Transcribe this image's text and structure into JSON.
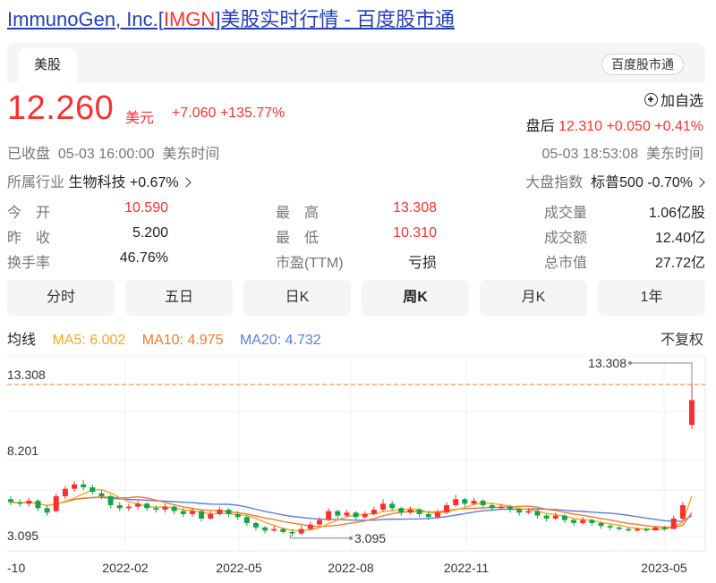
{
  "header": {
    "title_prefix": "ImmunoGen, Inc.[",
    "ticker": "IMGN",
    "title_suffix": "]美股实时行情 - 百度股市通"
  },
  "tabs": {
    "active": "美股",
    "brand_button": "百度股市通"
  },
  "quote": {
    "price": "12.260",
    "currency": "美元",
    "change": "+7.060 +135.77%",
    "add_watchlist": "加自选",
    "after_label": "盘后",
    "after_values": "12.310 +0.050 +0.41%",
    "status_left": "已收盘  05-03 16:00:00  美东时间",
    "status_right": "05-03 18:53:08  美东时间",
    "industry_label": "所属行业",
    "industry_value": "生物科技 +0.67%",
    "index_label": "大盘指数",
    "index_value": "标普500 -0.70%"
  },
  "stats": [
    [
      {
        "label": "今　开",
        "value": "10.590",
        "color": "#f73131"
      },
      {
        "label": "最　高",
        "value": "13.308",
        "color": "#f73131"
      },
      {
        "label": "成交量",
        "value": "1.06亿股",
        "color": "#222"
      }
    ],
    [
      {
        "label": "昨　收",
        "value": "5.200",
        "color": "#222"
      },
      {
        "label": "最　低",
        "value": "10.310",
        "color": "#f73131"
      },
      {
        "label": "成交额",
        "value": "12.40亿",
        "color": "#222"
      }
    ],
    [
      {
        "label": "换手率",
        "value": "46.76%",
        "color": "#222"
      },
      {
        "label": "市盈(TTM)",
        "value": "亏损",
        "color": "#222"
      },
      {
        "label": "总市值",
        "value": "27.72亿",
        "color": "#222"
      }
    ]
  ],
  "periods": [
    "分时",
    "五日",
    "日K",
    "周K",
    "月K",
    "1年"
  ],
  "active_period": "周K",
  "ma": {
    "label": "均线",
    "ma5": "MA5: 6.002",
    "ma5_color": "#f5a623",
    "ma10": "MA10: 4.975",
    "ma10_color": "#f07a2a",
    "ma20": "MA20: 4.732",
    "ma20_color": "#5b7fd6",
    "adjust": "不复权"
  },
  "chart_data": {
    "type": "candlestick",
    "y_ticks": [
      "13.308",
      "8.201",
      "3.095"
    ],
    "x_ticks": [
      "-10",
      "2022-02",
      "2022-05",
      "2022-08",
      "2022-11",
      "2023-05"
    ],
    "ylim": [
      3.095,
      13.308
    ],
    "max_label": "13.308",
    "min_label": "3.095",
    "up_color": "#f73131",
    "down_color": "#16a34a",
    "candles": [
      [
        5.6,
        5.4,
        5.8,
        5.2
      ],
      [
        5.4,
        5.3,
        5.6,
        5.1
      ],
      [
        5.3,
        5.5,
        5.7,
        5.1
      ],
      [
        5.5,
        5.0,
        5.6,
        4.8
      ],
      [
        5.0,
        4.7,
        5.2,
        4.5
      ],
      [
        4.8,
        5.8,
        6.0,
        4.7
      ],
      [
        5.8,
        6.3,
        6.5,
        5.6
      ],
      [
        6.3,
        6.6,
        6.8,
        6.1
      ],
      [
        6.6,
        6.4,
        6.9,
        6.2
      ],
      [
        6.4,
        6.1,
        6.6,
        5.9
      ],
      [
        6.0,
        5.8,
        6.2,
        5.6
      ],
      [
        5.8,
        5.2,
        5.9,
        5.0
      ],
      [
        5.2,
        5.0,
        5.4,
        4.8
      ],
      [
        5.0,
        5.1,
        5.3,
        4.8
      ],
      [
        5.1,
        5.3,
        5.5,
        4.9
      ],
      [
        5.3,
        5.0,
        5.4,
        4.8
      ],
      [
        5.0,
        4.9,
        5.2,
        4.7
      ],
      [
        4.9,
        5.1,
        5.3,
        4.7
      ],
      [
        5.1,
        4.8,
        5.2,
        4.6
      ],
      [
        4.8,
        4.6,
        5.0,
        4.4
      ],
      [
        4.6,
        4.8,
        5.0,
        4.4
      ],
      [
        4.8,
        4.3,
        4.9,
        4.1
      ],
      [
        4.3,
        4.6,
        4.8,
        4.2
      ],
      [
        4.6,
        4.9,
        5.1,
        4.5
      ],
      [
        4.9,
        4.6,
        5.0,
        4.4
      ],
      [
        4.6,
        4.4,
        4.8,
        4.2
      ],
      [
        4.4,
        4.0,
        4.5,
        3.8
      ],
      [
        4.0,
        3.7,
        4.1,
        3.5
      ],
      [
        3.7,
        3.5,
        3.8,
        3.3
      ],
      [
        3.5,
        3.6,
        3.8,
        3.4
      ],
      [
        3.6,
        3.4,
        3.7,
        3.3
      ],
      [
        3.4,
        3.3,
        3.6,
        3.1
      ],
      [
        3.3,
        3.6,
        3.8,
        3.2
      ],
      [
        3.6,
        3.9,
        4.1,
        3.5
      ],
      [
        3.9,
        4.2,
        4.4,
        3.8
      ],
      [
        4.2,
        4.8,
        5.0,
        4.1
      ],
      [
        4.8,
        4.5,
        4.9,
        4.3
      ],
      [
        4.5,
        4.7,
        4.9,
        4.4
      ],
      [
        4.7,
        4.4,
        4.8,
        4.2
      ],
      [
        4.4,
        4.6,
        4.8,
        4.3
      ],
      [
        4.6,
        4.9,
        5.1,
        4.5
      ],
      [
        4.9,
        5.3,
        5.6,
        4.8
      ],
      [
        5.3,
        5.0,
        5.5,
        4.8
      ],
      [
        5.0,
        4.7,
        5.1,
        4.5
      ],
      [
        4.7,
        4.9,
        5.1,
        4.6
      ],
      [
        4.9,
        4.6,
        5.0,
        4.4
      ],
      [
        4.6,
        4.4,
        4.8,
        4.2
      ],
      [
        4.4,
        4.7,
        4.9,
        4.3
      ],
      [
        4.7,
        5.2,
        5.4,
        4.6
      ],
      [
        5.2,
        5.6,
        5.9,
        5.1
      ],
      [
        5.6,
        5.3,
        5.7,
        5.1
      ],
      [
        5.3,
        5.5,
        5.7,
        5.2
      ],
      [
        5.5,
        5.2,
        5.6,
        5.0
      ],
      [
        5.2,
        5.0,
        5.3,
        4.8
      ],
      [
        5.0,
        5.1,
        5.3,
        4.9
      ],
      [
        5.1,
        4.9,
        5.2,
        4.7
      ],
      [
        4.9,
        4.7,
        5.0,
        4.5
      ],
      [
        4.7,
        4.8,
        5.0,
        4.6
      ],
      [
        4.8,
        4.5,
        4.9,
        4.3
      ],
      [
        4.5,
        4.3,
        4.6,
        4.1
      ],
      [
        4.3,
        4.5,
        4.7,
        4.2
      ],
      [
        4.5,
        4.2,
        4.6,
        4.0
      ],
      [
        4.2,
        4.0,
        4.3,
        3.8
      ],
      [
        4.0,
        4.2,
        4.4,
        3.9
      ],
      [
        4.2,
        4.0,
        4.3,
        3.8
      ],
      [
        4.0,
        3.8,
        4.1,
        3.6
      ],
      [
        3.8,
        3.7,
        3.9,
        3.5
      ],
      [
        3.7,
        3.6,
        3.8,
        3.5
      ],
      [
        3.6,
        3.5,
        3.7,
        3.4
      ],
      [
        3.5,
        3.6,
        3.7,
        3.4
      ],
      [
        3.6,
        3.5,
        3.7,
        3.4
      ],
      [
        3.5,
        3.7,
        3.8,
        3.5
      ],
      [
        3.7,
        3.6,
        3.8,
        3.5
      ],
      [
        3.6,
        4.3,
        4.5,
        3.6
      ],
      [
        4.3,
        5.2,
        5.4,
        4.2
      ],
      [
        10.59,
        12.26,
        13.308,
        10.31
      ]
    ]
  }
}
